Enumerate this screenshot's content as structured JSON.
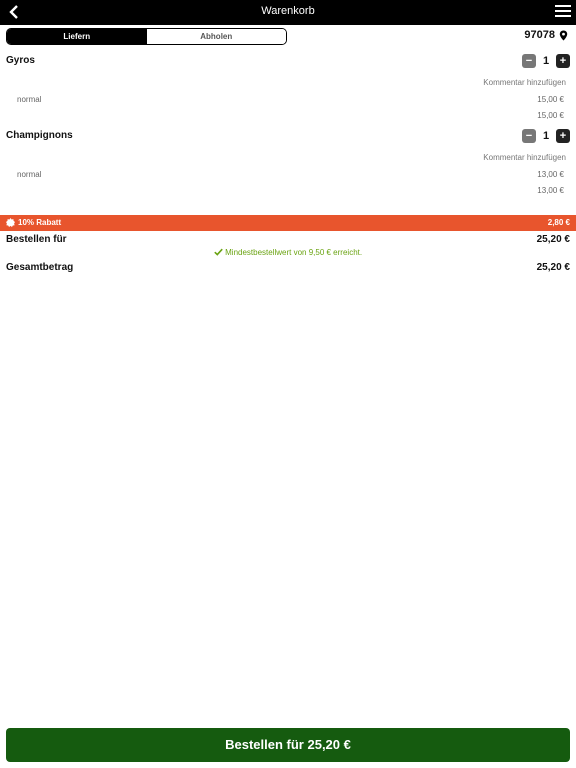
{
  "header": {
    "title": "Warenkorb"
  },
  "delivery_toggle": {
    "options": [
      "Liefern",
      "Abholen"
    ],
    "selected": "Liefern"
  },
  "location": {
    "zip": "97078"
  },
  "items": [
    {
      "name": "Gyros",
      "quantity": "1",
      "comment_link": "Kommentar hinzufügen",
      "variant": "normal",
      "variant_price": "15,00 €",
      "item_total": "15,00 €"
    },
    {
      "name": "Champignons",
      "quantity": "1",
      "comment_link": "Kommentar hinzufügen",
      "variant": "normal",
      "variant_price": "13,00 €",
      "item_total": "13,00 €"
    }
  ],
  "discount": {
    "label": "10% Rabatt",
    "amount": "2,80 €",
    "color": "#e8552d"
  },
  "summary": {
    "order_for_label": "Bestellen für",
    "order_for_value": "25,20 €",
    "min_order_note": "Mindestbestellwert von 9,50 € erreicht.",
    "total_label": "Gesamtbetrag",
    "total_value": "25,20 €"
  },
  "order_button": {
    "label": "Bestellen für 25,20 €",
    "color": "#155b0f"
  }
}
